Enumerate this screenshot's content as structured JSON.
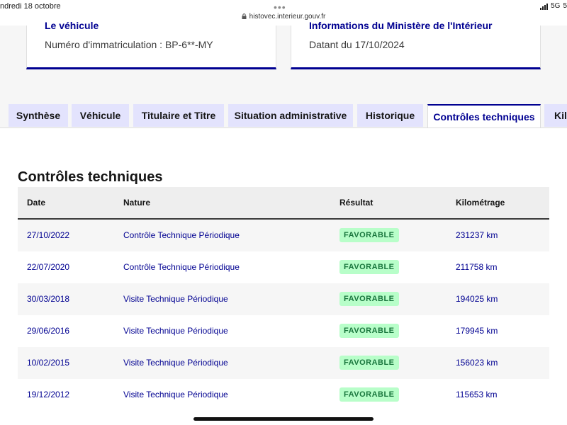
{
  "statusbar": {
    "date": "ndredi 18 octobre",
    "url": "histovec.interieur.gouv.fr",
    "network": "5G",
    "battery_fragment": "5"
  },
  "cards": {
    "vehicle": {
      "title": "Le véhicule",
      "text": "Numéro d'immatriculation : BP-6**-MY"
    },
    "ministry": {
      "title": "Informations du Ministère de l'Intérieur",
      "text": "Datant du 17/10/2024"
    }
  },
  "tabs": [
    {
      "label": "Synthèse",
      "active": false
    },
    {
      "label": "Véhicule",
      "active": false
    },
    {
      "label": "Titulaire et Titre",
      "active": false
    },
    {
      "label": "Situation administrative",
      "active": false
    },
    {
      "label": "Historique",
      "active": false
    },
    {
      "label": "Contrôles techniques",
      "active": true
    },
    {
      "label": "Kilo",
      "active": false
    }
  ],
  "section": {
    "title": "Contrôles techniques"
  },
  "table": {
    "headers": {
      "date": "Date",
      "nature": "Nature",
      "result": "Résultat",
      "km": "Kilométrage"
    },
    "rows": [
      {
        "date": "27/10/2022",
        "nature": "Contrôle Technique Périodique",
        "result": "FAVORABLE",
        "km": "231237 km"
      },
      {
        "date": "22/07/2020",
        "nature": "Contrôle Technique Périodique",
        "result": "FAVORABLE",
        "km": "211758 km"
      },
      {
        "date": "30/03/2018",
        "nature": "Visite Technique Périodique",
        "result": "FAVORABLE",
        "km": "194025 km"
      },
      {
        "date": "29/06/2016",
        "nature": "Visite Technique Périodique",
        "result": "FAVORABLE",
        "km": "179945 km"
      },
      {
        "date": "10/02/2015",
        "nature": "Visite Technique Périodique",
        "result": "FAVORABLE",
        "km": "156023 km"
      },
      {
        "date": "19/12/2012",
        "nature": "Visite Technique Périodique",
        "result": "FAVORABLE",
        "km": "115653 km"
      }
    ]
  },
  "colors": {
    "brand_blue": "#000091",
    "tab_bg": "#e3e3fd",
    "success_bg": "#b8fec9",
    "success_text": "#18753c"
  }
}
